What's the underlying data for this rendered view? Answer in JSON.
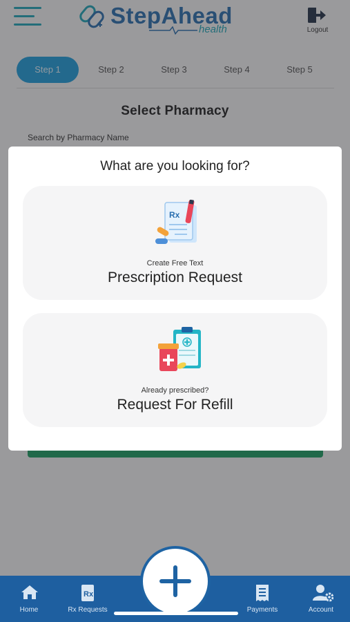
{
  "header": {
    "app_name": "StepAhead",
    "app_sub": "health",
    "logout_label": "Logout"
  },
  "steps": [
    "Step 1",
    "Step 2",
    "Step 3",
    "Step 4",
    "Step 5"
  ],
  "page": {
    "title": "Select Pharmacy",
    "search_label": "Search by Pharmacy Name"
  },
  "modal": {
    "title": "What are you looking for?",
    "options": [
      {
        "sub": "Create Free Text",
        "label": "Prescription Request",
        "icon": "prescription-icon"
      },
      {
        "sub": "Already prescribed?",
        "label": "Request For Refill",
        "icon": "refill-icon"
      }
    ]
  },
  "tabbar": {
    "items": [
      {
        "label": "Home",
        "icon": "home-icon"
      },
      {
        "label": "Rx Requests",
        "icon": "rx-icon"
      },
      {
        "label": "Payments",
        "icon": "receipt-icon"
      },
      {
        "label": "Account",
        "icon": "account-gear-icon"
      }
    ],
    "fab_icon": "plus-icon"
  },
  "colors": {
    "brand_blue": "#2a6fb0",
    "brand_teal": "#1fa7b8",
    "tabbar": "#1e5fa0",
    "active_step": "#1f9fdc",
    "green": "#1c9f63"
  }
}
